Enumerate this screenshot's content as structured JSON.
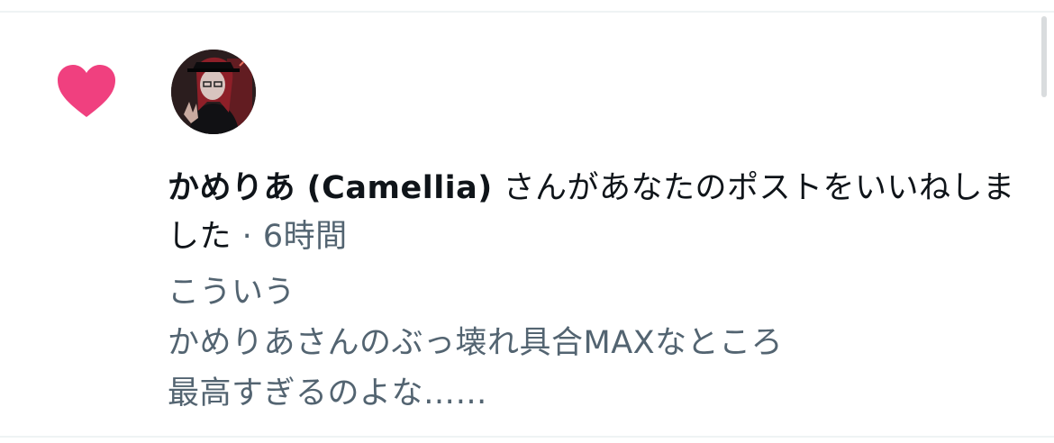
{
  "notification": {
    "user_name": "かめりあ (Camellia)",
    "action_text": " さんがあなたのポストをいいねしました",
    "separator": " · ",
    "time_ago": "6時間"
  },
  "post": {
    "lines": [
      "こういう",
      "かめりあさんのぶっ壊れ具合MAXなところ",
      "最高すぎるのよな……"
    ]
  },
  "icons": {
    "like": "heart-icon"
  },
  "colors": {
    "heart": "#f0407f",
    "primary_text": "#0f1419",
    "secondary_text": "#536471",
    "divider": "#eff3f4"
  }
}
